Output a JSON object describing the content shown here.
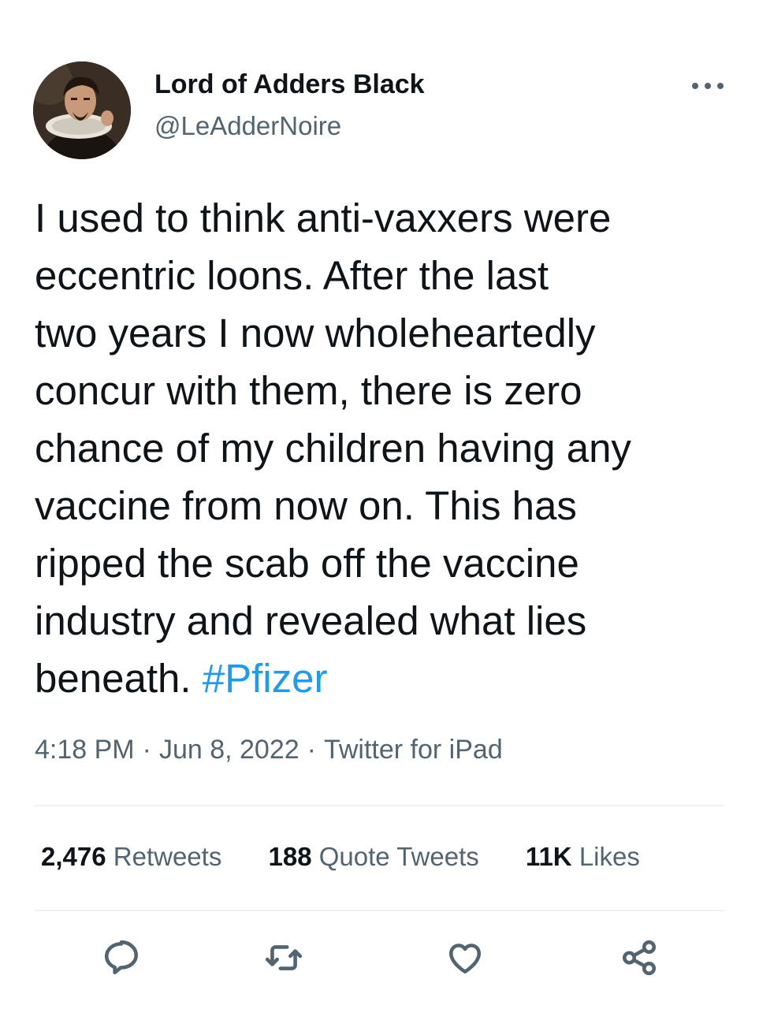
{
  "author": {
    "display_name": "Lord of Adders Black",
    "handle": "@LeAdderNoire"
  },
  "tweet": {
    "text_lines": [
      "I used to think anti-vaxxers were",
      "eccentric loons. After the last",
      "two years I now wholeheartedly",
      "concur with them, there is zero",
      "chance of my children having any",
      "vaccine from now on. This has",
      "ripped the scab off the vaccine",
      "industry and revealed what lies",
      "beneath. "
    ],
    "hashtag": "#Pfizer",
    "time": "4:18 PM",
    "separator": "·",
    "date": "Jun 8, 2022",
    "source": "Twitter for iPad"
  },
  "stats": {
    "retweets_count": "2,476",
    "retweets_label": "Retweets",
    "quotes_count": "188",
    "quotes_label": "Quote Tweets",
    "likes_count": "11K",
    "likes_label": "Likes"
  },
  "icons": {
    "more": "more-horizontal-icon",
    "reply": "reply-icon",
    "retweet": "retweet-icon",
    "like": "heart-icon",
    "share": "share-icon"
  },
  "colors": {
    "text": "#0f1419",
    "secondary": "#536471",
    "link": "#1d9bf0",
    "divider": "#eff3f4"
  }
}
